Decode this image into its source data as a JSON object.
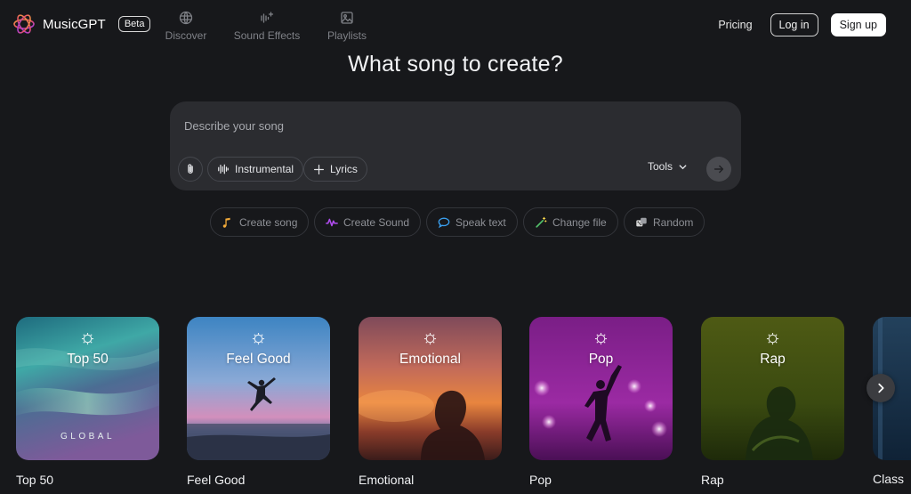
{
  "app": {
    "name": "MusicGPT",
    "badge": "Beta"
  },
  "nav": [
    {
      "label": "Discover",
      "icon": "globe-icon"
    },
    {
      "label": "Sound Effects",
      "icon": "waveform-sparkle-icon"
    },
    {
      "label": "Playlists",
      "icon": "image-icon"
    }
  ],
  "header": {
    "pricing": "Pricing",
    "login": "Log in",
    "signup": "Sign up"
  },
  "heading": "What song to create?",
  "prompt": {
    "placeholder": "Describe your song",
    "instrumental_label": "Instrumental",
    "lyrics_label": "Lyrics",
    "tools_label": "Tools"
  },
  "chips": [
    {
      "label": "Create song",
      "icon": "music-note-icon",
      "color": "#f0a93a"
    },
    {
      "label": "Create Sound",
      "icon": "waveform-icon",
      "color": "#b14cf0"
    },
    {
      "label": "Speak text",
      "icon": "speech-bubble-icon",
      "color": "#3aa0f0"
    },
    {
      "label": "Change file",
      "icon": "magic-wand-icon",
      "color": "#53c06a"
    },
    {
      "label": "Random",
      "icon": "dice-icon",
      "color": "#d7d7d7"
    }
  ],
  "cards": [
    {
      "title": "Top 50",
      "subtitle": "GLOBAL",
      "label": "Top 50"
    },
    {
      "title": "Feel Good",
      "label": "Feel Good"
    },
    {
      "title": "Emotional",
      "label": "Emotional"
    },
    {
      "title": "Pop",
      "label": "Pop"
    },
    {
      "title": "Rap",
      "label": "Rap"
    }
  ],
  "partial_card_label": "Class"
}
